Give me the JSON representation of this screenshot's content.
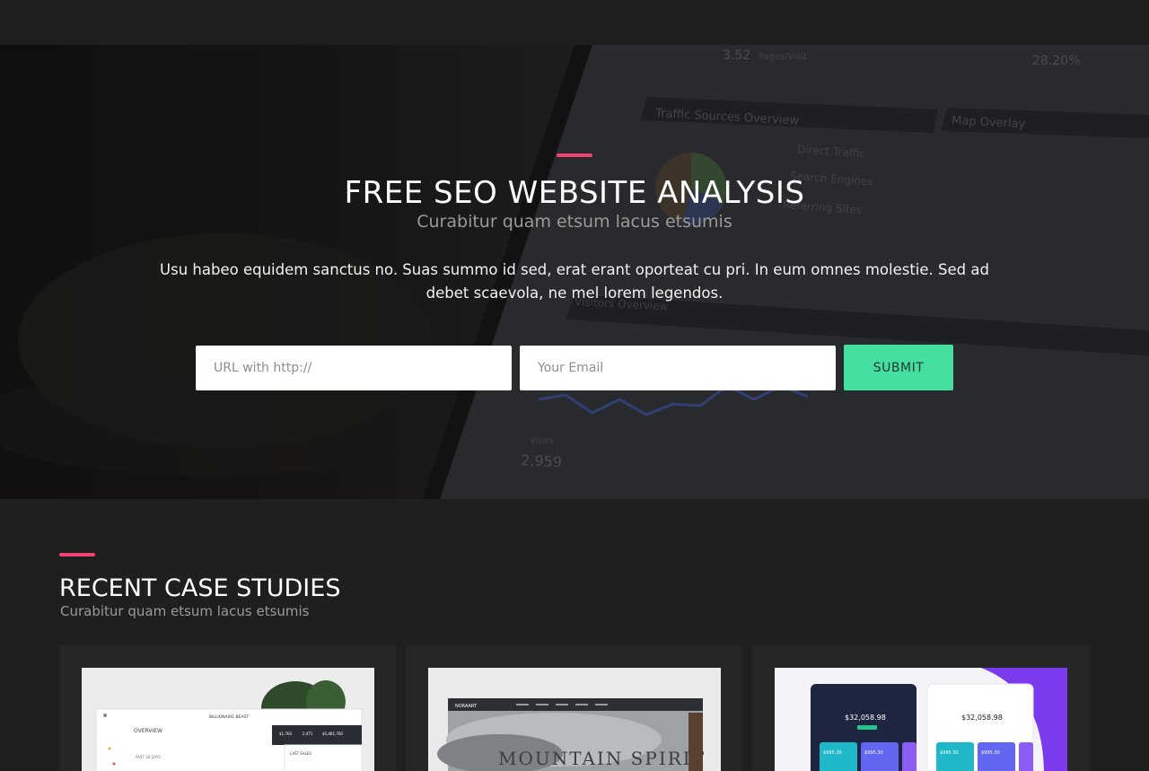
{
  "colors": {
    "accent": "#f0436f",
    "submit_bg": "#45dfa0",
    "page_bg": "#1f1f1f",
    "card_bg": "#262626"
  },
  "hero": {
    "title": "FREE SEO WEBSITE ANALYSIS",
    "subtitle": "Curabitur quam etsum lacus etsumis",
    "body": "Usu habeo equidem sanctus no. Suas summo id sed, erat erant oporteat cu pri. In eum omnes molestie. Sed ad debet scaevola, ne mel lorem legendos.",
    "form": {
      "url_placeholder": "URL with http://",
      "email_placeholder": "Your Email",
      "submit_label": "SUBMIT"
    },
    "background": {
      "traffic_value": "3.52",
      "traffic_unit": "Pages/Visit",
      "percent_value": "28.20%",
      "traffic_sources_title": "Traffic Sources Overview",
      "map_title": "Map Overlay",
      "legend": [
        "Direct Traffic",
        "Search Engines",
        "Referring Sites"
      ],
      "bottom_label": "Visits",
      "bottom_value": "2,959",
      "visitors_title": "Visitors Overview"
    }
  },
  "case_studies": {
    "title": "RECENT CASE STUDIES",
    "subtitle": "Curabitur quam etsum lacus etsumis",
    "cards": [
      {
        "brand": "BILLIONAIRE BEAST",
        "heading": "OVERVIEW",
        "period": "PAST 30 DAYS",
        "stats": [
          "$1,760",
          "2,471",
          "$5,481,760"
        ],
        "list_title": "LAST SALES"
      },
      {
        "brand": "NORAART",
        "headline": "MOUNTAIN SPIRIT"
      },
      {
        "amount_left": "$32,058.98",
        "amount_right": "$32,058.98",
        "tile_values": [
          "$995.30",
          "$995.30",
          "$995.30",
          "$995.30",
          "$995.30"
        ]
      }
    ]
  }
}
